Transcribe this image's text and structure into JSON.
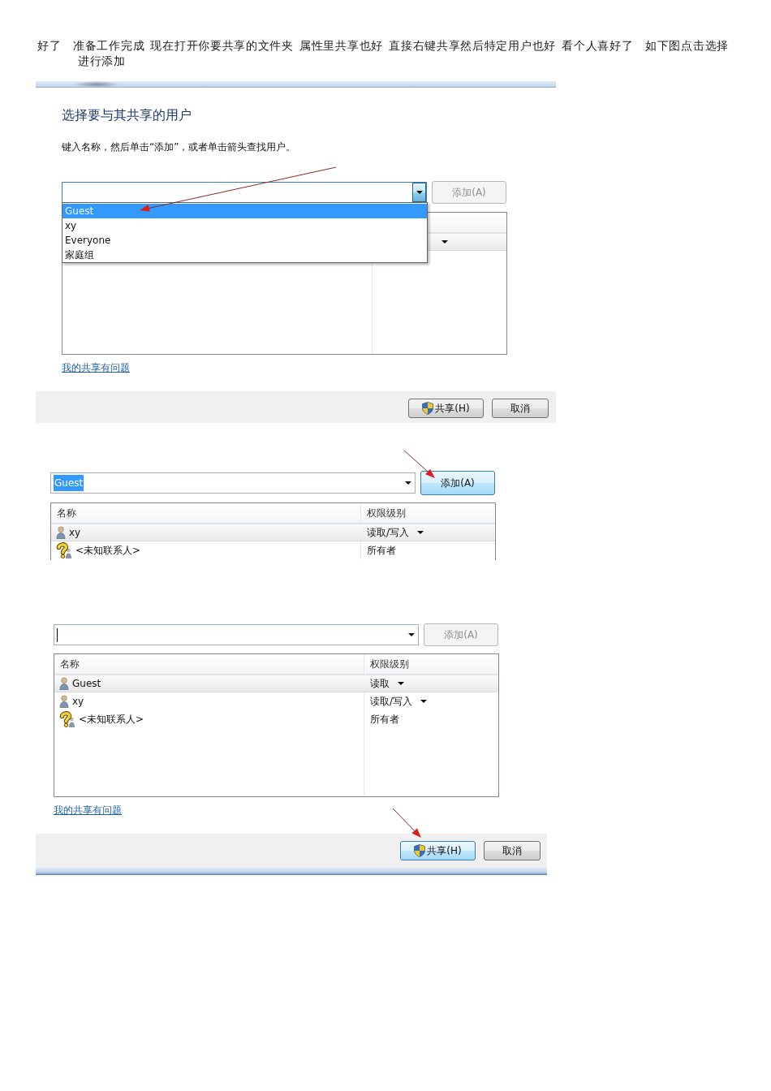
{
  "intro": "好了　准备工作完成 现在打开你要共享的文件夹 属性里共享也好 直接右键共享然后特定用户也好 看个人喜好了　如下图点击选择进行添加",
  "screenshots": [
    {
      "frame_top": true,
      "title": "选择要与其共享的用户",
      "instruction": "键入名称，然后单击“添加”，或者单击箭头查找用户。",
      "combo": {
        "open": true,
        "items": [
          {
            "label": "Guest",
            "selected": true
          },
          {
            "label": "xy",
            "selected": false
          },
          {
            "label": "Everyone",
            "selected": false
          },
          {
            "label": "家庭组",
            "selected": false
          }
        ]
      },
      "add_button": {
        "label": "添加(A)",
        "disabled": true,
        "hovered": false
      },
      "list": {
        "rows": [
          {
            "selected": true,
            "dropdown": true
          }
        ]
      },
      "link": "我的共享有问题",
      "buttons": [
        {
          "label": "共享(H)",
          "shield": true,
          "hovered": false
        },
        {
          "label": "取消",
          "shield": false,
          "hovered": false
        }
      ],
      "pointer_arrow": true
    },
    {
      "combo": {
        "value": "Guest",
        "value_selected": true,
        "open": false
      },
      "add_button": {
        "label": "添加(A)",
        "disabled": false,
        "hovered": true
      },
      "list": {
        "columns": [
          "名称",
          "权限级别"
        ],
        "rows": [
          {
            "kind": "user",
            "name": "xy",
            "permission": "读取/写入",
            "selected": true,
            "dropdown": true
          },
          {
            "kind": "unknown_contact",
            "name": "<未知联系人>",
            "permission": "所有者",
            "selected": false,
            "dropdown": false
          }
        ]
      },
      "pointer_arrow": true
    },
    {
      "frame_bottom": true,
      "combo": {
        "open": false,
        "text_cursor": true
      },
      "add_button": {
        "label": "添加(A)",
        "disabled": true,
        "hovered": false
      },
      "list": {
        "columns": [
          "名称",
          "权限级别"
        ],
        "rows": [
          {
            "kind": "user",
            "name": "Guest",
            "permission": "读取",
            "selected": true,
            "dropdown": true
          },
          {
            "kind": "user",
            "name": "xy",
            "permission": "读取/写入",
            "selected": false,
            "dropdown": true
          },
          {
            "kind": "unknown_contact",
            "name": "<未知联系人>",
            "permission": "所有者",
            "selected": false,
            "dropdown": false
          }
        ]
      },
      "link": "我的共享有问题",
      "buttons": [
        {
          "label": "共享(H)",
          "shield": true,
          "hovered": true
        },
        {
          "label": "取消",
          "shield": false,
          "hovered": false
        }
      ],
      "pointer_arrow": true
    }
  ]
}
